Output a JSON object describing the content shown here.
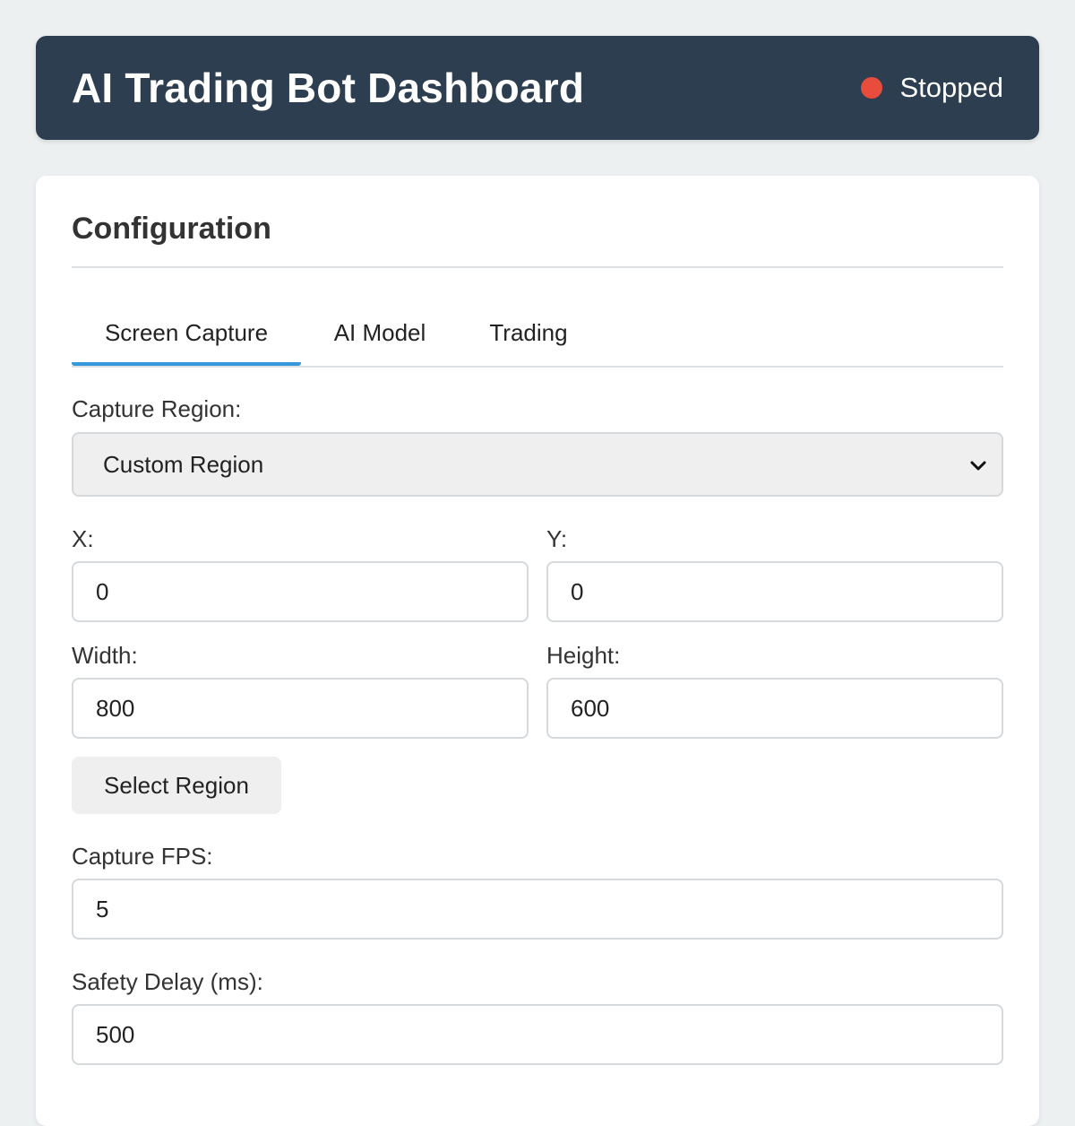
{
  "header": {
    "title": "AI Trading Bot Dashboard",
    "status_text": "Stopped",
    "status_color": "#e74c3c"
  },
  "config": {
    "title": "Configuration",
    "tabs": [
      {
        "label": "Screen Capture",
        "active": true
      },
      {
        "label": "AI Model",
        "active": false
      },
      {
        "label": "Trading",
        "active": false
      }
    ],
    "capture_region": {
      "label": "Capture Region:",
      "selected": "Custom Region"
    },
    "x": {
      "label": "X:",
      "value": "0"
    },
    "y": {
      "label": "Y:",
      "value": "0"
    },
    "width": {
      "label": "Width:",
      "value": "800"
    },
    "height": {
      "label": "Height:",
      "value": "600"
    },
    "select_region_label": "Select Region",
    "fps": {
      "label": "Capture FPS:",
      "value": "5"
    },
    "safety_delay": {
      "label": "Safety Delay (ms):",
      "value": "500"
    }
  },
  "colors": {
    "header_bg": "#2c3e50",
    "accent": "#3498db",
    "page_bg": "#ecf0f1"
  }
}
